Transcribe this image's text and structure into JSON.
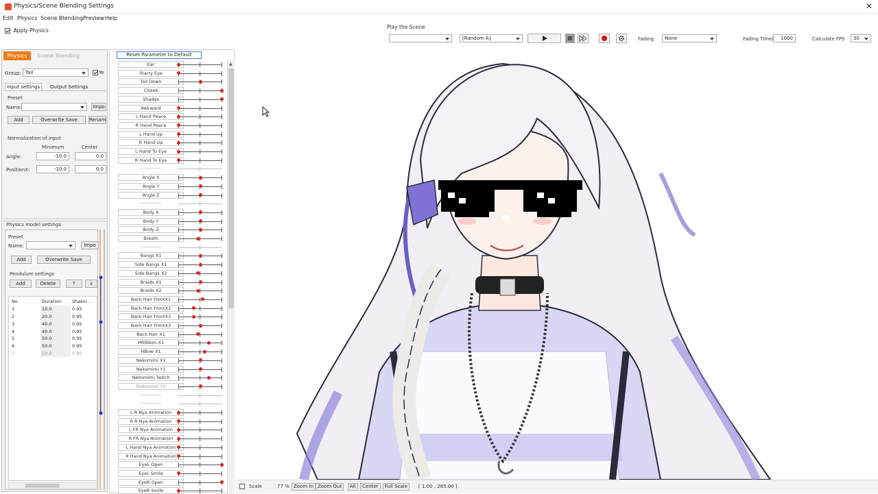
{
  "window": {
    "title": "Physics/Scene Blending Settings",
    "close": "✕"
  },
  "menu": [
    "Edit",
    "Physics",
    "Scene Blending",
    "Preview",
    "Help"
  ],
  "apply_physics": {
    "label": "Apply Physics",
    "checked": true
  },
  "play_scene": {
    "label": "Play the Scene",
    "scene_value": "",
    "mode_value": "[Random A]",
    "fading_label": "Fading:",
    "fading_value": "None",
    "fading_time_label": "Fading Time(ms):",
    "fading_time_value": "1000",
    "calc_fps_label": "Calculate FPS",
    "calc_fps_value": "30"
  },
  "left_tabs": {
    "active": "Physics",
    "inactive": "Scene Blending"
  },
  "group": {
    "label": "Group:",
    "value": "Tail",
    "check_label": "Ye"
  },
  "input_tabs": {
    "active": "Input settings",
    "inactive": "Output Settings"
  },
  "preset": {
    "label": "Preset",
    "name_label": "Name:",
    "import": "Impo",
    "add": "Add",
    "overwrite": "Overwrite Save",
    "rename": "Renam"
  },
  "normalization": {
    "label": "Normalization of input",
    "col_min": "Minimum",
    "col_center": "Center",
    "rows": [
      {
        "name": "Angle:",
        "min": "-10.0",
        "center": "0.0"
      },
      {
        "name": "PositionX:",
        "min": "-10.0",
        "center": "0.0"
      }
    ]
  },
  "physics_model": {
    "label": "Physics model settings",
    "preset": "Preset",
    "name_label": "Name:",
    "import": "Impo",
    "add": "Add",
    "overwrite": "Overwrite Save",
    "pendulum_label": "Pendulum settings",
    "p_add": "Add",
    "p_delete": "Delete",
    "p_up": "↑",
    "p_down": "↓",
    "columns": [
      "No",
      "Duration",
      "Shakin..."
    ],
    "rows": [
      [
        "1",
        "10.0",
        "0.95"
      ],
      [
        "2",
        "20.0",
        "0.95"
      ],
      [
        "3",
        "40.0",
        "0.95"
      ],
      [
        "4",
        "40.0",
        "0.95"
      ],
      [
        "5",
        "50.0",
        "0.95"
      ],
      [
        "6",
        "50.0",
        "0.95"
      ],
      [
        "7",
        "50.0",
        "0.95"
      ]
    ]
  },
  "reset_button": "Reset Parameter to Default",
  "parameters": [
    {
      "name": "Ear",
      "v": 0.0
    },
    {
      "name": "Starry Eye",
      "v": 0.0
    },
    {
      "name": "Tail Down",
      "v": 0.5
    },
    {
      "name": "Cheek",
      "v": 1.0
    },
    {
      "name": "Shades",
      "v": 1.0
    },
    {
      "name": "Awkward",
      "v": 0.0
    },
    {
      "name": "L Hand Peace",
      "v": 0.0
    },
    {
      "name": "R Hand Peace",
      "v": 0.0
    },
    {
      "name": "L Hand Up",
      "v": 0.0
    },
    {
      "name": "R Hand Up",
      "v": 0.0
    },
    {
      "name": "L Hand To Eye",
      "v": 0.0
    },
    {
      "name": "R Hand To Eye",
      "v": 0.0
    },
    {
      "name": "-------------",
      "sep": true
    },
    {
      "name": "Angle X",
      "v": 0.5
    },
    {
      "name": "Angle Y",
      "v": 0.5
    },
    {
      "name": "Angle Z",
      "v": 0.5
    },
    {
      "name": "-------------",
      "sep": true
    },
    {
      "name": "Body X",
      "v": 0.5
    },
    {
      "name": "Body Y",
      "v": 0.5
    },
    {
      "name": "Body Z",
      "v": 0.5
    },
    {
      "name": "Breath",
      "v": 0.45
    },
    {
      "name": "-------------",
      "sep": true
    },
    {
      "name": "Bangs X1",
      "v": 0.5
    },
    {
      "name": "Side Bangs X1",
      "v": 0.5
    },
    {
      "name": "Side Bangs X2",
      "v": 0.45
    },
    {
      "name": "Braids X1",
      "v": 0.5
    },
    {
      "name": "Braids X2",
      "v": 0.45
    },
    {
      "name": "Back Hair FrontX1",
      "v": 0.55
    },
    {
      "name": "Back Hair FrontX2",
      "v": 0.35
    },
    {
      "name": "Back Hair FrontX3",
      "v": 0.35
    },
    {
      "name": "Back Hair FrontX3",
      "v": 0.5
    },
    {
      "name": "Back Hair X1",
      "v": 0.45
    },
    {
      "name": "HRibbon X1",
      "v": 0.7
    },
    {
      "name": "HBow X1",
      "v": 0.6
    },
    {
      "name": "Nekomimi X1",
      "v": 0.5
    },
    {
      "name": "Nekomimi Y1",
      "v": 0.5
    },
    {
      "name": "Nekomimi Twitch",
      "v": 0.7
    },
    {
      "name": "Nekomimi Y1",
      "v": 0.5,
      "dim": true
    },
    {
      "name": "-------------",
      "sep": true
    },
    {
      "name": "-------------",
      "sep": true
    },
    {
      "name": "L R Nya Animation",
      "v": 0.0
    },
    {
      "name": "R R Nya Animation",
      "v": 0.0
    },
    {
      "name": "L FR Nya Animation",
      "v": 0.0
    },
    {
      "name": "R FR Nya Animation",
      "v": 0.0
    },
    {
      "name": "L Hand Nya Animation",
      "v": 0.0
    },
    {
      "name": "R Hand Nya Animation",
      "v": 0.0
    },
    {
      "name": "EyeL Open",
      "v": 1.0
    },
    {
      "name": "EyeL Smile",
      "v": 0.0
    },
    {
      "name": "EyeR Open",
      "v": 1.0
    },
    {
      "name": "EyeR Smile",
      "v": 0.0
    }
  ],
  "status": {
    "scale_label": "Scale",
    "zoom": "77 %",
    "zoom_in": "Zoom In",
    "zoom_out": "Zoom Out",
    "all": "All",
    "center": "Center",
    "full_scale": "Full Scale",
    "coords": "[   1.00  ,  285.00  ]"
  },
  "colors": {
    "accent": "#f07a16",
    "knob": "#dd2222",
    "record": "#dd1111",
    "hair_outline": "#6a5fc4"
  }
}
